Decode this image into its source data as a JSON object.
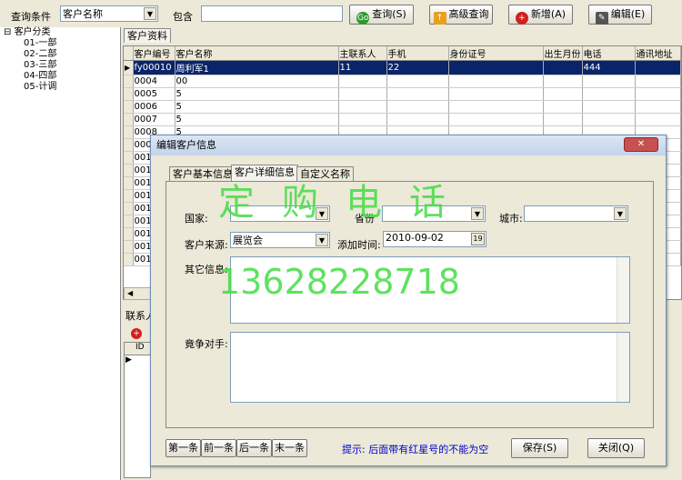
{
  "toolbar": {
    "query_condition_label": "查询条件",
    "field_select_value": "客户名称",
    "contains_label": "包含",
    "search_value": "",
    "query_button": "查询(S)",
    "advanced_button": "高级查询",
    "add_button": "新增(A)",
    "edit_button": "编辑(E)"
  },
  "tree": {
    "root": "客户分类",
    "items": [
      "01-一部",
      "02-二部",
      "03-三部",
      "04-四部",
      "05-计调"
    ]
  },
  "grid": {
    "tab": "客户资料",
    "columns": [
      "客户编号",
      "客户名称",
      "主联系人",
      "手机",
      "身份证号",
      "出生月份",
      "电话",
      "通讯地址"
    ],
    "rows": [
      [
        "fy00010",
        "周利军1",
        "11",
        "22",
        "",
        "",
        "444",
        ""
      ],
      [
        "0004",
        "00",
        "",
        "",
        "",
        "",
        "",
        ""
      ],
      [
        "0005",
        "5",
        "",
        "",
        "",
        "",
        "",
        ""
      ],
      [
        "0006",
        "5",
        "",
        "",
        "",
        "",
        "",
        ""
      ],
      [
        "0007",
        "5",
        "",
        "",
        "",
        "",
        "",
        ""
      ],
      [
        "0008",
        "5",
        "",
        "",
        "",
        "",
        "",
        ""
      ],
      [
        "000",
        "",
        "",
        "",
        "",
        "",
        "",
        ""
      ],
      [
        "001",
        "",
        "",
        "",
        "",
        "",
        "",
        ""
      ],
      [
        "001",
        "",
        "",
        "",
        "",
        "",
        "",
        ""
      ],
      [
        "001",
        "",
        "",
        "",
        "",
        "",
        "",
        ""
      ],
      [
        "001",
        "",
        "",
        "",
        "",
        "",
        "",
        ""
      ],
      [
        "001",
        "",
        "",
        "",
        "",
        "",
        "",
        ""
      ],
      [
        "001",
        "",
        "",
        "",
        "",
        "",
        "",
        ""
      ],
      [
        "001",
        "",
        "",
        "",
        "",
        "",
        "",
        ""
      ],
      [
        "001",
        "",
        "",
        "",
        "",
        "",
        "",
        ""
      ],
      [
        "001",
        "",
        "",
        "",
        "",
        "",
        "",
        ""
      ]
    ]
  },
  "contacts": {
    "tab": "联系人",
    "id_col": "ID"
  },
  "dialog": {
    "title": "编辑客户信息",
    "tabs": [
      "客户基本信息",
      "客户详细信息",
      "自定义名称"
    ],
    "country_label": "国家:",
    "province_label": "省份",
    "city_label": "城市:",
    "source_label": "客户来源:",
    "source_value": "展览会",
    "added_time_label": "添加时间:",
    "added_time_value": "2010-09-02",
    "other_info_label": "其它信息:",
    "competitor_label": "竟争对手:",
    "nav_first": "第一条",
    "nav_prev": "前一条",
    "nav_next": "后一条",
    "nav_last": "末一条",
    "hint": "提示: 后面带有红星号的不能为空",
    "save_button": "保存(S)",
    "close_button": "关闭(Q)"
  },
  "watermark": {
    "line1": "定购电话",
    "line2": "13628228718"
  },
  "colors": {
    "selection": "#0a246a",
    "watermark": "#44dd44",
    "hint": "#0000cc"
  }
}
